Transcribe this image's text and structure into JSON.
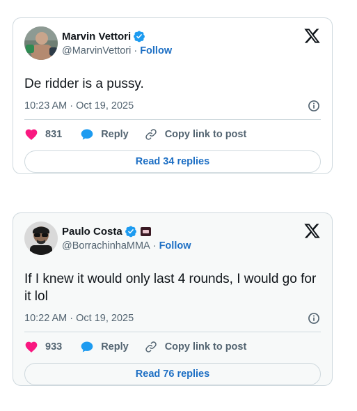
{
  "tweets": [
    {
      "name": "Marvin Vettori",
      "handle": "@MarvinVettori",
      "follow_label": "Follow",
      "text": "De ridder is a pussy.",
      "timestamp": "10:23 AM · Oct 19, 2025",
      "likes": "831",
      "reply_label": "Reply",
      "copy_label": "Copy link to post",
      "read_replies": "Read 34 replies"
    },
    {
      "name": "Paulo Costa",
      "handle": "@BorrachinhaMMA",
      "follow_label": "Follow",
      "text": "If I knew it would only last 4 rounds, I would go for it lol",
      "timestamp": "10:22 AM · Oct 19, 2025",
      "likes": "933",
      "reply_label": "Reply",
      "copy_label": "Copy link to post",
      "read_replies": "Read 76 replies"
    }
  ],
  "colors": {
    "verified": "#1d9bf0",
    "like": "#f91880",
    "reply_icon": "#1d9bf0",
    "link": "#1d6fc4"
  },
  "icons": [
    "verified-badge-icon",
    "x-logo-icon",
    "info-icon",
    "heart-icon",
    "reply-bubble-icon",
    "link-icon"
  ]
}
